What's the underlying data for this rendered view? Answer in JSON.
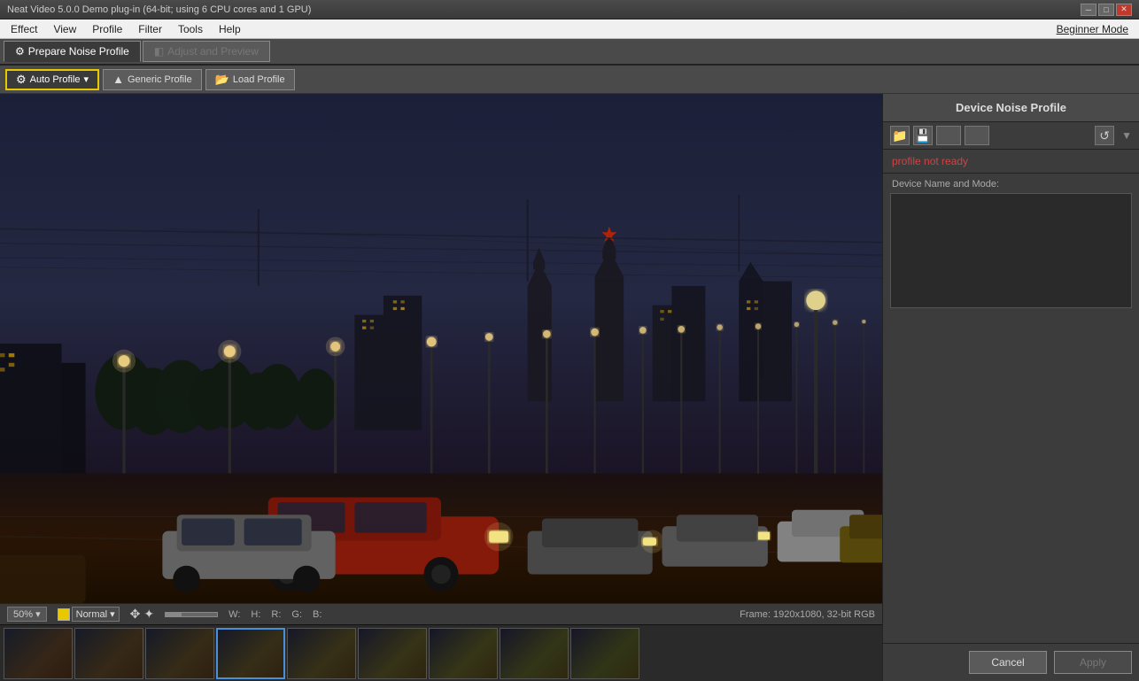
{
  "title_bar": {
    "text": "Neat Video 5.0.0  Demo plug-in (64-bit; using 6 CPU cores and 1 GPU)"
  },
  "menu_bar": {
    "items": [
      "Effect",
      "View",
      "Profile",
      "Filter",
      "Tools",
      "Help"
    ],
    "beginner_mode": "Beginner Mode"
  },
  "tabs": {
    "prepare": "Prepare Noise Profile",
    "adjust": "Adjust and Preview"
  },
  "toolbar": {
    "auto_profile": "Auto Profile",
    "generic_profile": "Generic Profile",
    "load_profile": "Load Profile"
  },
  "panel": {
    "header": "Device Noise Profile",
    "profile_status": "profile not ready",
    "device_name_label": "Device Name and Mode:"
  },
  "status_bar": {
    "zoom": "50%",
    "mode": "Normal",
    "w_label": "W:",
    "h_label": "H:",
    "r_label": "R:",
    "g_label": "G:",
    "b_label": "B:",
    "frame_info": "Frame: 1920x1080, 32-bit RGB"
  },
  "bottom_buttons": {
    "cancel": "Cancel",
    "apply": "Apply"
  },
  "filmstrip": {
    "frame_count": 9,
    "selected_index": 3
  }
}
